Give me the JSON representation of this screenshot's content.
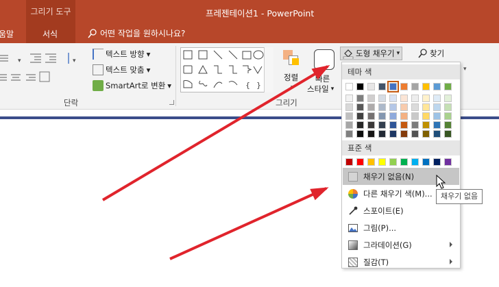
{
  "titlebar": {
    "context_tab": "그리기 도구",
    "window_title": "프레젠테이션1  -  PowerPoint"
  },
  "tabs": {
    "partial": "움말",
    "format": "서식",
    "tell_me": "어떤 작업을 원하시나요?"
  },
  "ribbon": {
    "paragraph": {
      "text_direction": "텍스트 방향",
      "align_text": "텍스트 맞춤",
      "smartart": "SmartArt로 변환",
      "label": "단락"
    },
    "drawing": {
      "arrange": "정렬",
      "quick_styles_line1": "빠른",
      "quick_styles_line2": "스타일",
      "label": "그리기"
    },
    "shape_fill": "도형 채우기",
    "find": "찾기"
  },
  "fill_dropdown": {
    "theme_colors_label": "테마 색",
    "standard_colors_label": "표준 색",
    "theme_top_row": [
      "#ffffff",
      "#000000",
      "#e7e6e6",
      "#44546a",
      "#4472c4",
      "#ed7d31",
      "#a5a5a5",
      "#ffc000",
      "#5b9bd5",
      "#70ad47"
    ],
    "theme_shades": [
      [
        "#f2f2f2",
        "#d9d9d9",
        "#bfbfbf",
        "#a6a6a6",
        "#808080"
      ],
      [
        "#7f7f7f",
        "#595959",
        "#404040",
        "#262626",
        "#0d0d0d"
      ],
      [
        "#d0cece",
        "#aeabab",
        "#757171",
        "#3a3838",
        "#171616"
      ],
      [
        "#d6dce4",
        "#adb9ca",
        "#8497b0",
        "#333f4f",
        "#222a35"
      ],
      [
        "#dae3f3",
        "#b4c7e7",
        "#8faadc",
        "#2f5597",
        "#1f3864"
      ],
      [
        "#fbe5d6",
        "#f8cbad",
        "#f4b183",
        "#c55a11",
        "#843c0c"
      ],
      [
        "#ededed",
        "#dbdbdb",
        "#c9c9c9",
        "#7b7b7b",
        "#525252"
      ],
      [
        "#fff2cc",
        "#ffe699",
        "#ffd966",
        "#bf9000",
        "#7f6000"
      ],
      [
        "#deebf7",
        "#bdd7ee",
        "#9dc3e6",
        "#2e75b6",
        "#1f4e79"
      ],
      [
        "#e2f0d9",
        "#c5e0b4",
        "#a9d18e",
        "#548235",
        "#385723"
      ]
    ],
    "standard_colors": [
      "#c00000",
      "#ff0000",
      "#ffc000",
      "#ffff00",
      "#92d050",
      "#00b050",
      "#00b0f0",
      "#0070c0",
      "#002060",
      "#7030a0"
    ],
    "items": {
      "no_fill": "채우기 없음(N)",
      "more_colors": "다른 채우기 색(M)...",
      "eyedropper": "스포이트(E)",
      "picture": "그림(P)...",
      "gradient": "그라데이션(G)",
      "texture": "질감(T)"
    }
  },
  "tooltip": "채우기 없음",
  "annotation_color": "#e0242c"
}
